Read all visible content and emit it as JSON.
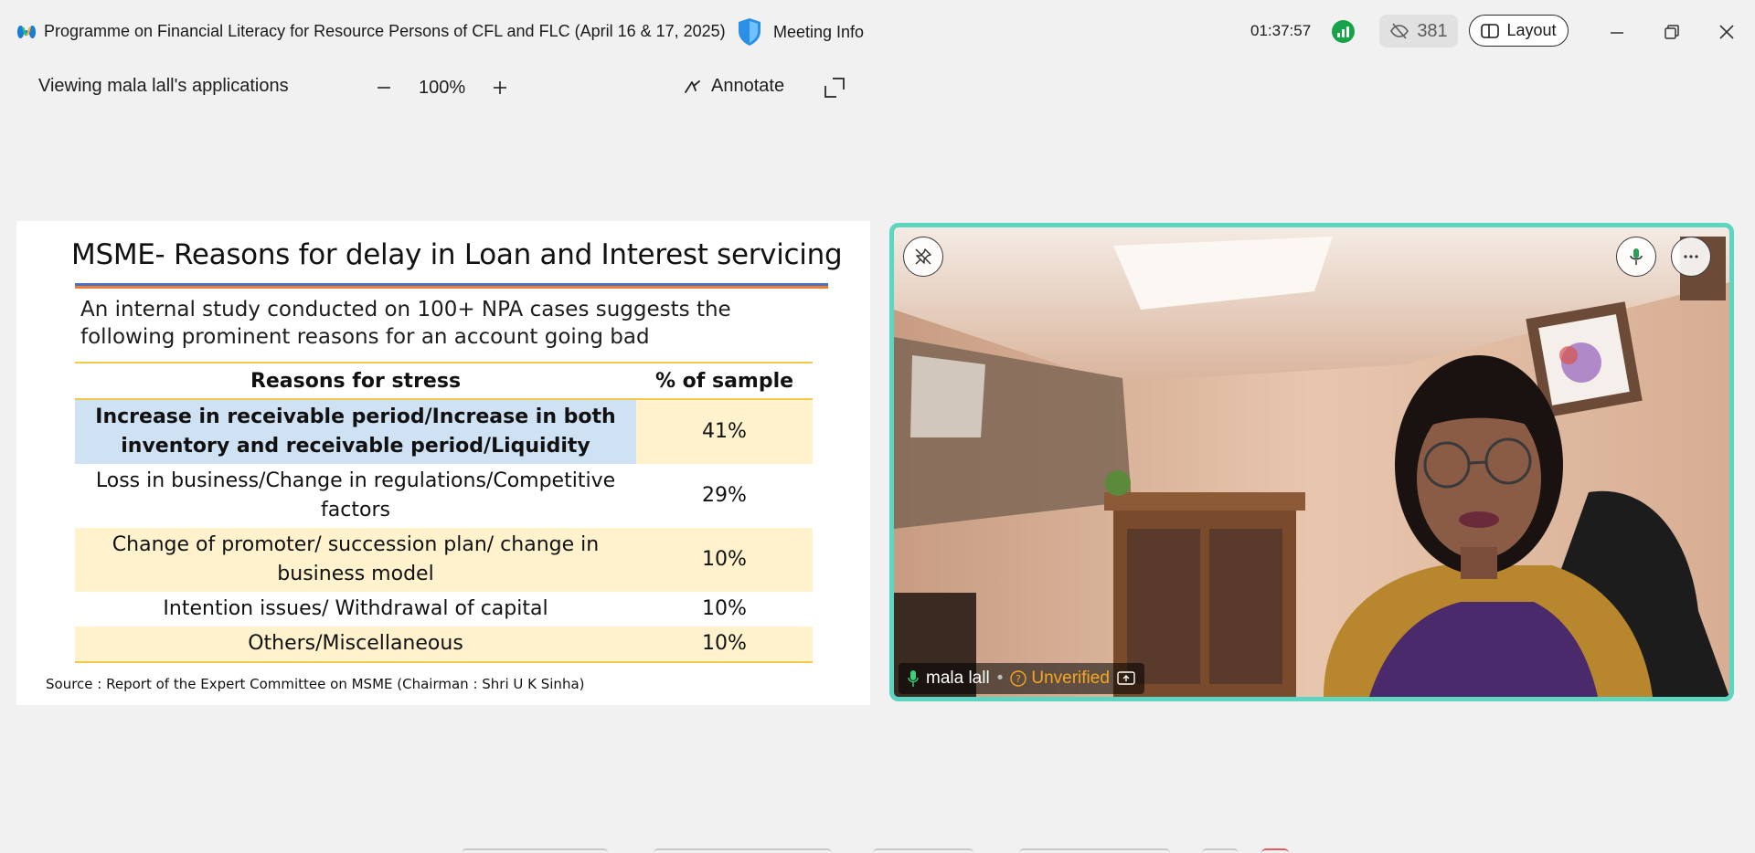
{
  "titlebar": {
    "title": "Programme on Financial Literacy for Resource Persons of CFL and FLC (April 16 & 17, 2025)",
    "meeting_info": "Meeting Info",
    "timer": "01:37:57",
    "viewer_count": "381",
    "layout_label": "Layout"
  },
  "share_toolbar": {
    "viewing_label": "Viewing mala lall's applications",
    "zoom": "100%",
    "annotate_label": "Annotate"
  },
  "slide": {
    "title": "MSME- Reasons for delay in Loan and Interest servicing",
    "intro": "An internal study conducted on 100+ NPA cases suggests the following prominent reasons for an account going bad",
    "table": {
      "headers": [
        "Reasons for stress",
        "% of sample"
      ],
      "rows": [
        {
          "reason": "Increase in receivable period/Increase in both inventory and receivable period/Liquidity",
          "pct": "41%"
        },
        {
          "reason": "Loss in business/Change in regulations/Competitive factors",
          "pct": "29%"
        },
        {
          "reason": "Change of promoter/ succession plan/ change in business model",
          "pct": "10%"
        },
        {
          "reason": "Intention issues/ Withdrawal of capital",
          "pct": "10%"
        },
        {
          "reason": "Others/Miscellaneous",
          "pct": "10%"
        }
      ]
    },
    "source": "Source : Report of the Expert Committee on MSME (Chairman : Shri U K Sinha)"
  },
  "video": {
    "participant_name": "mala lall",
    "verification": "Unverified"
  },
  "colors": {
    "accent_border": "#5cd6c0",
    "signal_green": "#16a34a",
    "unverified_orange": "#f5a623",
    "table_highlight_blue": "#cfe2f3",
    "table_highlight_yellow": "#fff2cc"
  }
}
